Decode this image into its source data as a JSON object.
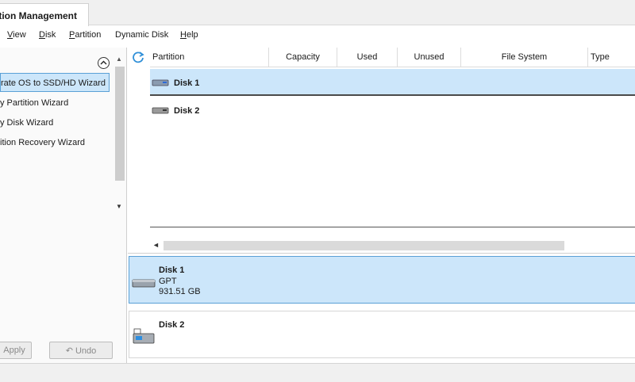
{
  "tab": {
    "title": "tition Management"
  },
  "menu": [
    {
      "label": "View",
      "u": "V",
      "rest": "iew"
    },
    {
      "label": "Disk",
      "u": "D",
      "rest": "isk"
    },
    {
      "label": "Partition",
      "u": "P",
      "rest": "artition"
    },
    {
      "label": "Dynamic Disk",
      "u": "",
      "rest": "Dynamic Disk"
    },
    {
      "label": "Help",
      "u": "H",
      "rest": "elp"
    }
  ],
  "left_panel": {
    "collapse_icon": "chevron-up-icon",
    "wizards": [
      "rate OS to SSD/HD Wizard",
      "y Partition Wizard",
      "y Disk Wizard",
      "ition Recovery Wizard"
    ],
    "apply_label": "Apply",
    "undo_label": "Undo",
    "undo_icon": "undo-arrow-icon"
  },
  "table": {
    "refresh_icon": "refresh-icon",
    "headers": [
      "Partition",
      "Capacity",
      "Used",
      "Unused",
      "File System",
      "Type"
    ],
    "rows": [
      {
        "name": "Disk 1",
        "selected": true
      },
      {
        "name": "Disk 2",
        "selected": false
      }
    ]
  },
  "disk_map": [
    {
      "name": "Disk 1",
      "scheme": "GPT",
      "size": "931.51 GB",
      "selected": true,
      "icon": "hdd-icon"
    },
    {
      "name": "Disk 2",
      "scheme": "",
      "size": "",
      "selected": false,
      "icon": "usb-drive-icon"
    }
  ],
  "colors": {
    "selection": "#cce6fa",
    "selection_border": "#5aa0d6",
    "refresh": "#2f8fd8"
  }
}
